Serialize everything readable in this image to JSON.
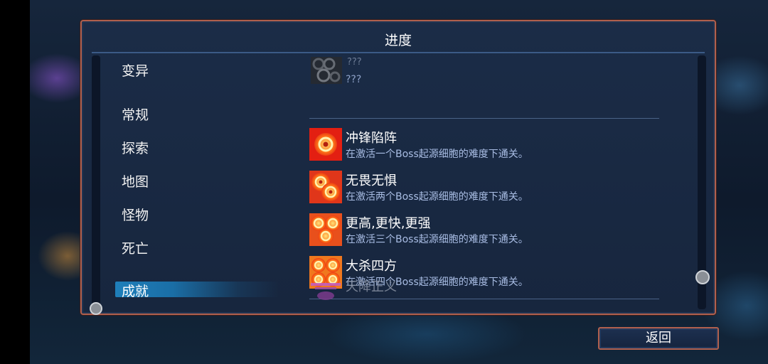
{
  "panel": {
    "title": "进度"
  },
  "categories": [
    {
      "label": "变异"
    },
    {
      "label": "常规"
    },
    {
      "label": "探索"
    },
    {
      "label": "地图"
    },
    {
      "label": "怪物"
    },
    {
      "label": "死亡"
    },
    {
      "label": "成就",
      "selected": true
    }
  ],
  "locked_entry": {
    "name": "???",
    "desc": "???"
  },
  "achievements": [
    {
      "name": "冲锋陷阵",
      "desc": "在激活一个Boss起源细胞的难度下通关。",
      "icon": "one-flame-eye-icon"
    },
    {
      "name": "无畏无惧",
      "desc": "在激活两个Boss起源细胞的难度下通关。",
      "icon": "two-flame-eyes-icon"
    },
    {
      "name": "更高,更快,更强",
      "desc": "在激活三个Boss起源细胞的难度下通关。",
      "icon": "three-flame-eyes-icon"
    },
    {
      "name": "大杀四方",
      "desc": "在激活四个Boss起源细胞的难度下通关。",
      "icon": "four-flame-eyes-icon"
    }
  ],
  "next_entry": {
    "name": "天降正义",
    "icon": "purple-pillar-icon"
  },
  "buttons": {
    "back": "返回"
  },
  "colors": {
    "frame": "#b0604e",
    "selected": "#1f7fba",
    "desc_text": "#a9bde4"
  }
}
